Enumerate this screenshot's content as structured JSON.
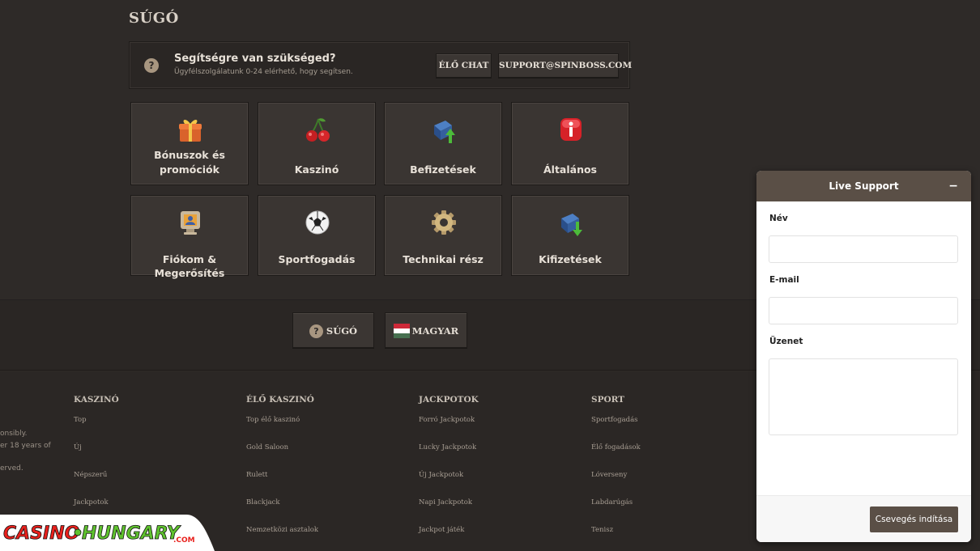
{
  "page": {
    "title": "SÚGÓ"
  },
  "help": {
    "title": "Segítségre van szükséged?",
    "subtitle": "Ügyfélszolgálatunk 0-24 elérhető, hogy segítsen.",
    "icon": "?",
    "live_chat_label": "ÉLŐ CHAT",
    "email_label": "SUPPORT@SPINBOSS.COM"
  },
  "categories": [
    {
      "label": "Bónuszok és promóciók",
      "line1": "Bónuszok és",
      "line2": "promóciók",
      "icon": "gift-icon"
    },
    {
      "label": "Kaszinó",
      "icon": "cherry-icon"
    },
    {
      "label": "Befizetések",
      "icon": "deposit-icon"
    },
    {
      "label": "Általános",
      "icon": "info-icon"
    },
    {
      "label": "Fiókom & Megerősítés",
      "icon": "account-icon"
    },
    {
      "label": "Sportfogadás",
      "icon": "football-icon"
    },
    {
      "label": "Technikai rész",
      "icon": "gear-icon"
    },
    {
      "label": "Kifizetések",
      "icon": "withdraw-icon"
    }
  ],
  "bottom_nav": {
    "help_icon": "?",
    "help_label": "SÚGÓ",
    "language_label": "MAGYAR"
  },
  "footer": {
    "left_text": [
      "onsibly.",
      "er 18 years of",
      "erved."
    ],
    "columns": [
      {
        "heading": "KASZINÓ",
        "links": [
          "Top",
          "Új",
          "Népszerű",
          "Jackpotok"
        ]
      },
      {
        "heading": "ÉLŐ KASZINÓ",
        "links": [
          "Top élő kaszinó",
          "Gold Saloon",
          "Rulett",
          "Blackjack",
          "Nemzetközi asztalok"
        ]
      },
      {
        "heading": "JACKPOTOK",
        "links": [
          "Forró Jackpotok",
          "Lucky Jackpotok",
          "Új Jackpotok",
          "Napi Jackpotok",
          "Jackpot játék"
        ]
      },
      {
        "heading": "SPORT",
        "links": [
          "Sportfogadás",
          "Élő fogadások",
          "Lóverseny",
          "Labdarúgás",
          "Tenisz"
        ]
      }
    ]
  },
  "chat": {
    "title": "Live Support",
    "minimize": "−",
    "name_label": "Név",
    "email_label": "E-mail",
    "message_label": "Üzenet",
    "start_label": "Csevegés indítása"
  },
  "logo": {
    "text_left": "CASINO",
    "text_right": "HUNGARY",
    "suffix": ".COM"
  },
  "colors": {
    "accent": "#5a4f46",
    "background": "#2e2a28",
    "tile": "#3a3532",
    "logo_red": "#e8201c",
    "logo_green": "#5fc22e"
  }
}
